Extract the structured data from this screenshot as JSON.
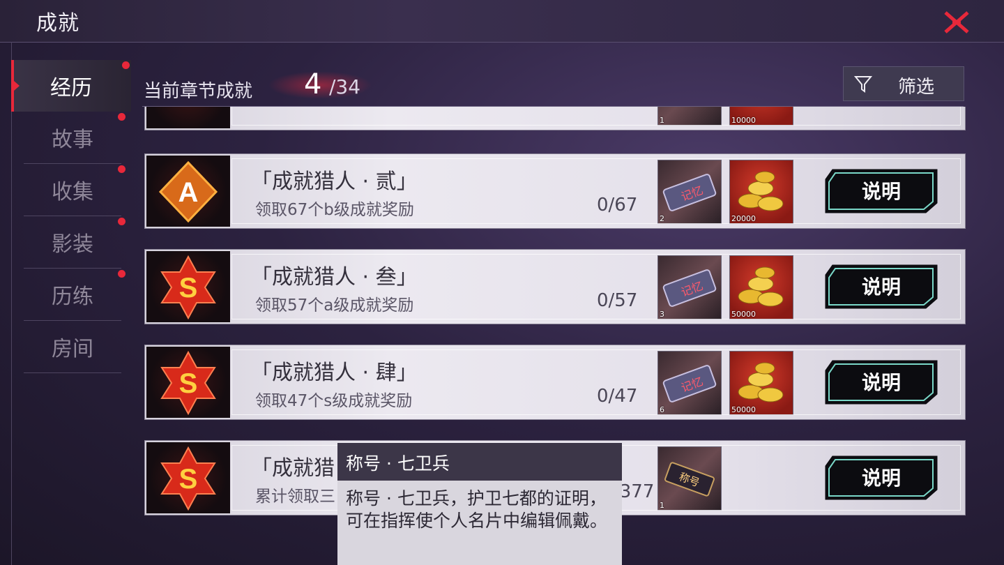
{
  "window": {
    "title": "成就",
    "close_icon": "close-x-icon",
    "accent": "#e8283a"
  },
  "sidebar": {
    "tabs": [
      {
        "label": "经历",
        "active": true,
        "has_dot": true
      },
      {
        "label": "故事",
        "active": false,
        "has_dot": true
      },
      {
        "label": "收集",
        "active": false,
        "has_dot": true
      },
      {
        "label": "影装",
        "active": false,
        "has_dot": true
      },
      {
        "label": "历练",
        "active": false,
        "has_dot": true
      },
      {
        "label": "房间",
        "active": false,
        "has_dot": false
      }
    ]
  },
  "header": {
    "label": "当前章节成就",
    "current": "4",
    "total": "/34"
  },
  "filter": {
    "label": "筛选",
    "icon": "funnel-icon"
  },
  "partial_row": {
    "ticket_qty": "1",
    "coin_qty": "10000"
  },
  "achievements": [
    {
      "badge": "A",
      "name": "「成就猎人 · 贰」",
      "desc": "领取67个b级成就奖励",
      "progress": "0/67",
      "rewards": [
        {
          "type": "memory-ticket",
          "label": "记忆",
          "qty": "2"
        },
        {
          "type": "coins",
          "qty": "20000"
        }
      ],
      "button": "说明"
    },
    {
      "badge": "S",
      "name": "「成就猎人 · 叁」",
      "desc": "领取57个a级成就奖励",
      "progress": "0/57",
      "rewards": [
        {
          "type": "memory-ticket",
          "label": "记忆",
          "qty": "3"
        },
        {
          "type": "coins",
          "qty": "50000"
        }
      ],
      "button": "说明"
    },
    {
      "badge": "S",
      "name": "「成就猎人 · 肆」",
      "desc": "领取47个s级成就奖励",
      "progress": "0/47",
      "rewards": [
        {
          "type": "memory-ticket",
          "label": "记忆",
          "qty": "6"
        },
        {
          "type": "coins",
          "qty": "50000"
        }
      ],
      "button": "说明"
    },
    {
      "badge": "S",
      "name": "「成就猎",
      "desc": "累计领取三",
      "progress": "/377",
      "rewards": [
        {
          "type": "title-ticket",
          "label": "称号",
          "qty": "1"
        }
      ],
      "button": "说明"
    }
  ],
  "tooltip": {
    "title": "称号 · 七卫兵",
    "body": "称号 · 七卫兵，护卫七都的证明，可在指挥使个人名片中编辑佩戴。"
  }
}
